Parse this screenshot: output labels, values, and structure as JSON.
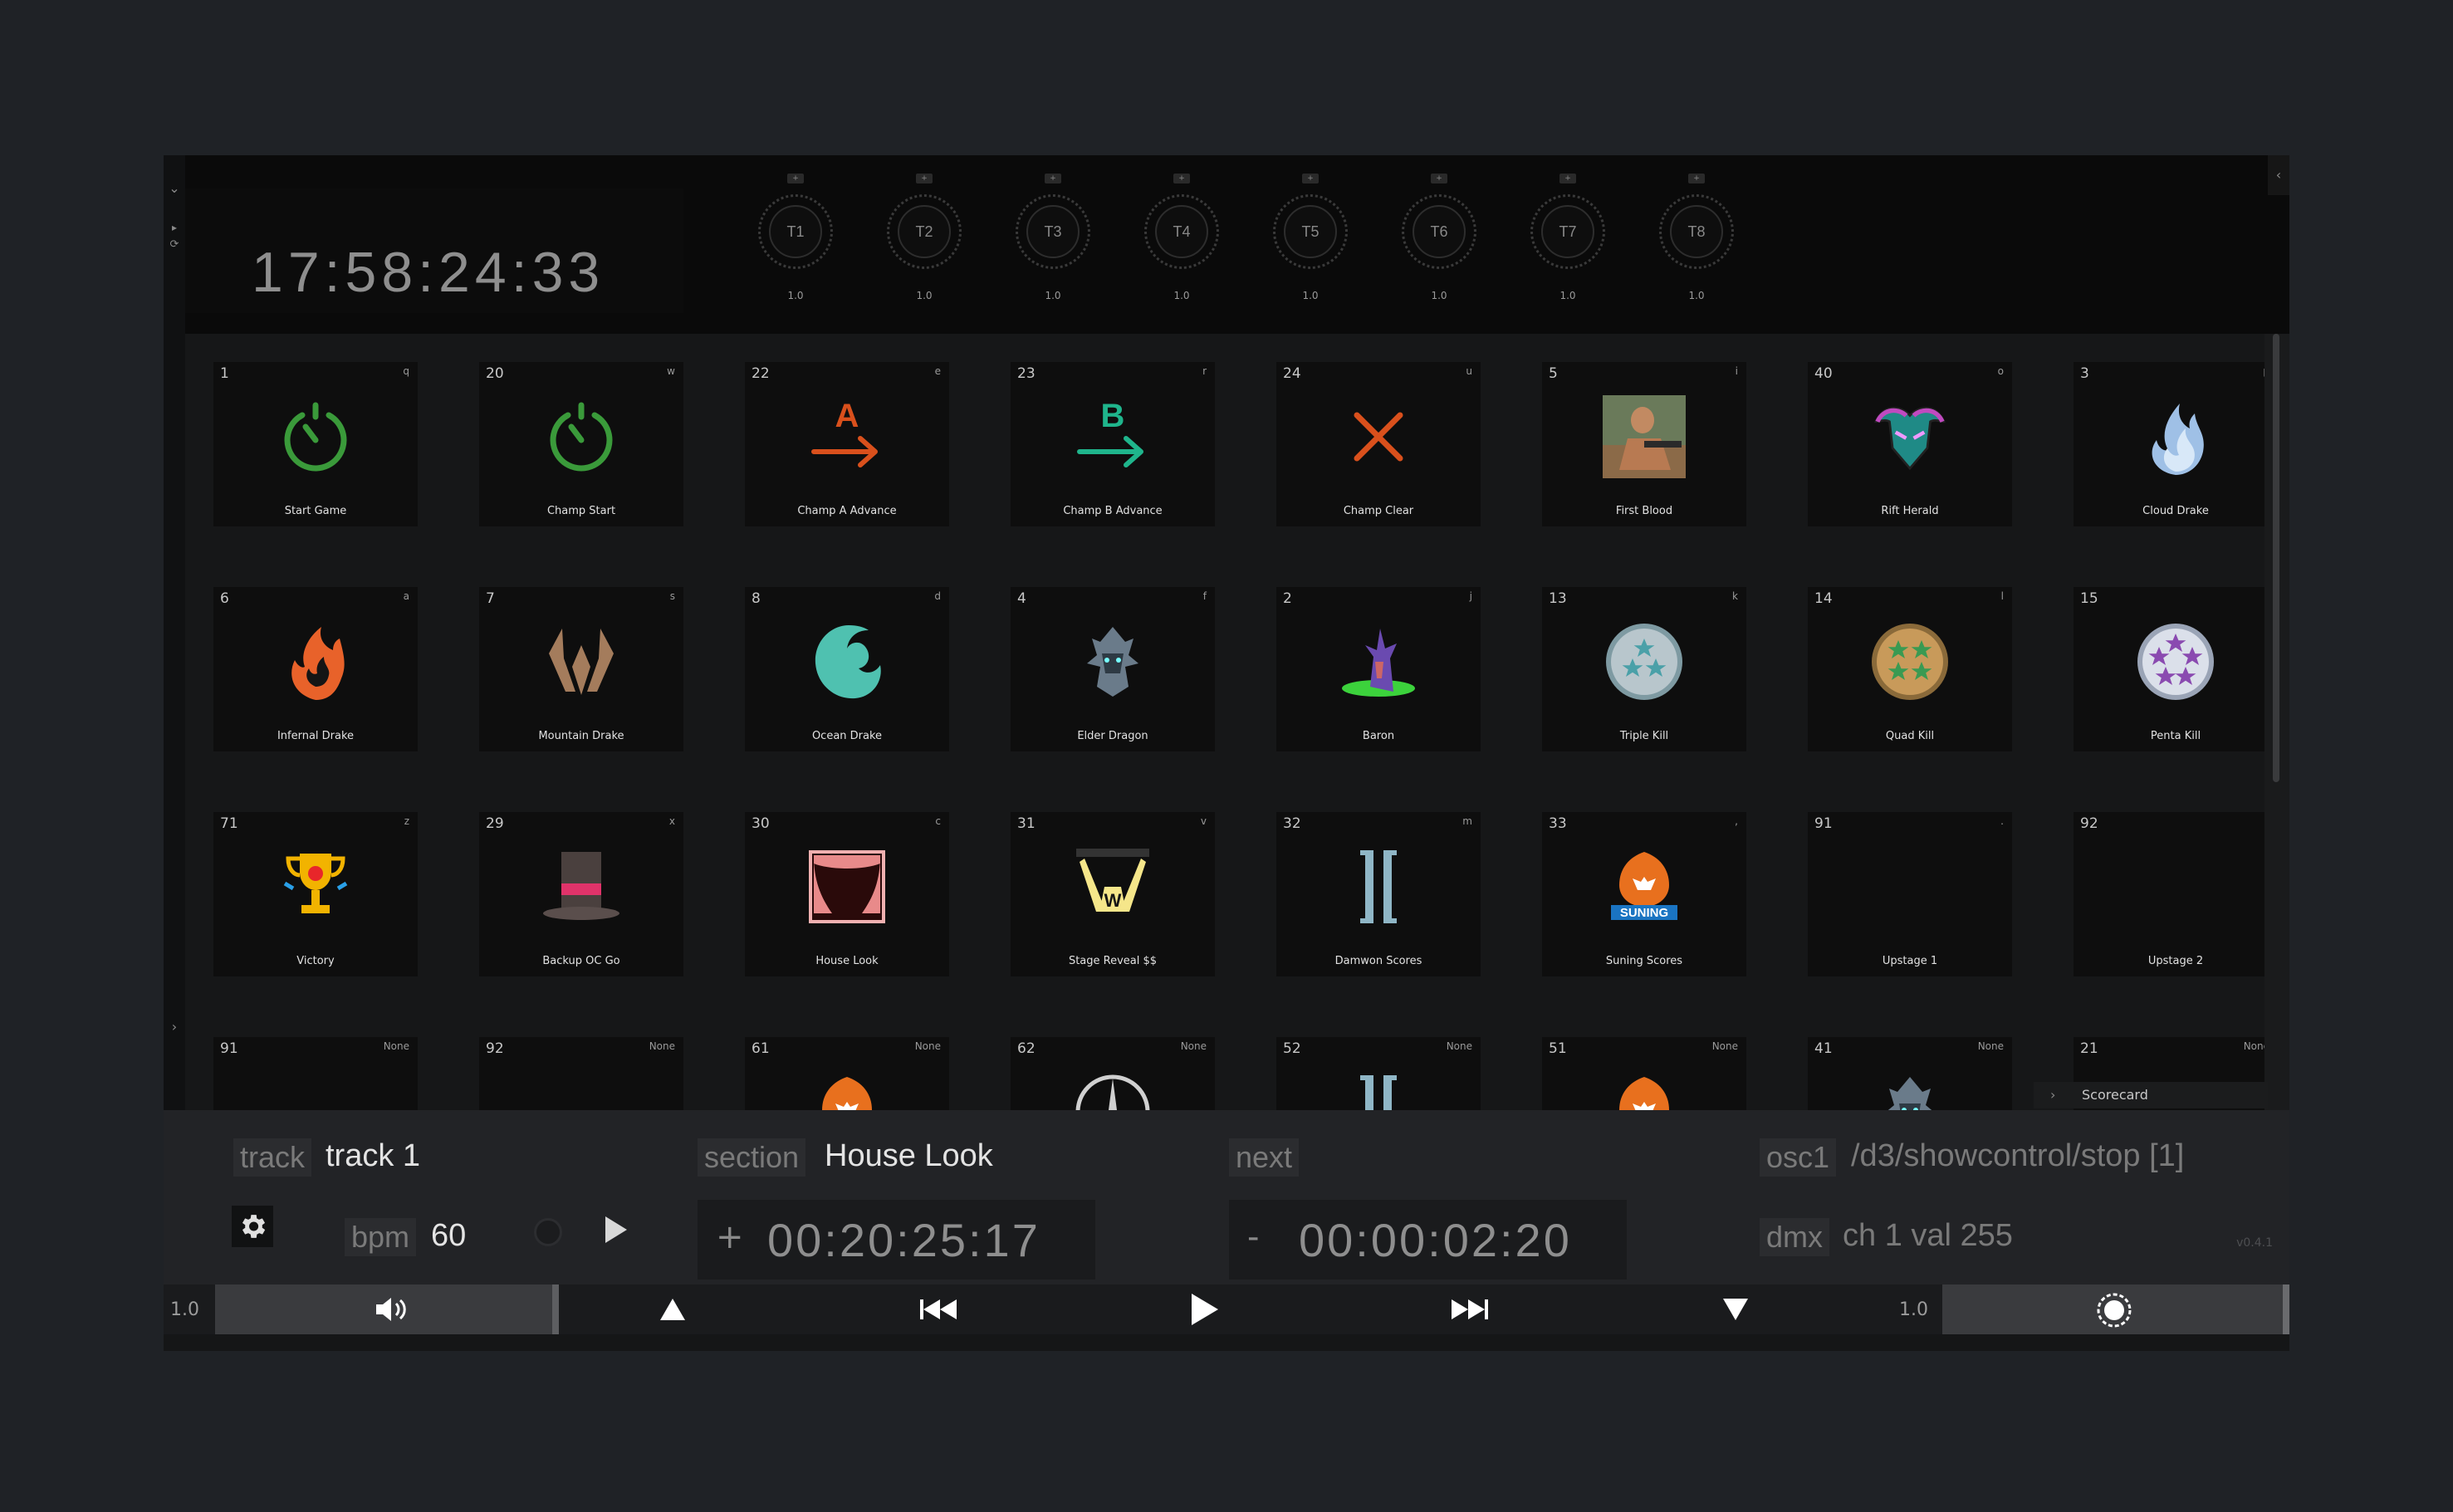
{
  "clock": {
    "time": "17:58:24:33"
  },
  "knobs": [
    {
      "label": "T1",
      "value": "1.0"
    },
    {
      "label": "T2",
      "value": "1.0"
    },
    {
      "label": "T3",
      "value": "1.0"
    },
    {
      "label": "T4",
      "value": "1.0"
    },
    {
      "label": "T5",
      "value": "1.0"
    },
    {
      "label": "T6",
      "value": "1.0"
    },
    {
      "label": "T7",
      "value": "1.0"
    },
    {
      "label": "T8",
      "value": "1.0"
    }
  ],
  "tiles": [
    {
      "id": "1",
      "key": "q",
      "label": "Start Game",
      "icon": "power-timer-green-icon"
    },
    {
      "id": "20",
      "key": "w",
      "label": "Champ Start",
      "icon": "power-timer-green-icon"
    },
    {
      "id": "22",
      "key": "e",
      "label": "Champ A Advance",
      "icon": "arrow-a-orange-icon"
    },
    {
      "id": "23",
      "key": "r",
      "label": "Champ B Advance",
      "icon": "arrow-b-teal-icon"
    },
    {
      "id": "24",
      "key": "u",
      "label": "Champ Clear",
      "icon": "x-orange-icon"
    },
    {
      "id": "5",
      "key": "i",
      "label": "First Blood",
      "icon": "first-blood-photo-icon"
    },
    {
      "id": "40",
      "key": "o",
      "label": "Rift Herald",
      "icon": "rift-herald-icon"
    },
    {
      "id": "3",
      "key": "p",
      "label": "Cloud Drake",
      "icon": "cloud-drake-icon"
    },
    {
      "id": "6",
      "key": "a",
      "label": "Infernal Drake",
      "icon": "infernal-drake-icon"
    },
    {
      "id": "7",
      "key": "s",
      "label": "Mountain Drake",
      "icon": "mountain-drake-icon"
    },
    {
      "id": "8",
      "key": "d",
      "label": "Ocean Drake",
      "icon": "ocean-drake-icon"
    },
    {
      "id": "4",
      "key": "f",
      "label": "Elder Dragon",
      "icon": "elder-dragon-icon"
    },
    {
      "id": "2",
      "key": "j",
      "label": "Baron",
      "icon": "baron-icon"
    },
    {
      "id": "13",
      "key": "k",
      "label": "Triple Kill",
      "icon": "triple-kill-badge-icon"
    },
    {
      "id": "14",
      "key": "l",
      "label": "Quad Kill",
      "icon": "quad-kill-badge-icon"
    },
    {
      "id": "15",
      "key": ";",
      "label": "Penta Kill",
      "icon": "penta-kill-badge-icon"
    },
    {
      "id": "71",
      "key": "z",
      "label": "Victory",
      "icon": "trophy-icon"
    },
    {
      "id": "29",
      "key": "x",
      "label": "Backup OC Go",
      "icon": "top-hat-icon"
    },
    {
      "id": "30",
      "key": "c",
      "label": "House Look",
      "icon": "theater-curtain-icon"
    },
    {
      "id": "31",
      "key": "v",
      "label": "Stage Reveal $$",
      "icon": "stage-spotlights-icon"
    },
    {
      "id": "32",
      "key": "m",
      "label": "Damwon Scores",
      "icon": "damwon-logo-icon"
    },
    {
      "id": "33",
      "key": ",",
      "label": "Suning Scores",
      "icon": "suning-logo-icon"
    },
    {
      "id": "91",
      "key": ".",
      "label": "Upstage 1",
      "icon": ""
    },
    {
      "id": "92",
      "key": "/",
      "label": "Upstage 2",
      "icon": ""
    },
    {
      "id": "91",
      "key": "None",
      "label": "",
      "icon": ""
    },
    {
      "id": "92",
      "key": "None",
      "label": "",
      "icon": ""
    },
    {
      "id": "61",
      "key": "None",
      "label": "",
      "icon": "suning-logo-icon"
    },
    {
      "id": "62",
      "key": "None",
      "label": "",
      "icon": "mercedes-logo-icon"
    },
    {
      "id": "52",
      "key": "None",
      "label": "",
      "icon": "damwon-logo-icon"
    },
    {
      "id": "51",
      "key": "None",
      "label": "",
      "icon": "suning-logo-icon"
    },
    {
      "id": "41",
      "key": "None",
      "label": "",
      "icon": "elder-dragon-icon"
    },
    {
      "id": "21",
      "key": "None",
      "label": "",
      "icon": ""
    }
  ],
  "scorecard": {
    "label": "Scorecard"
  },
  "info": {
    "track_tag": "track",
    "track_value": "track 1",
    "section_tag": "section",
    "section_value": "House Look",
    "next_tag": "next",
    "osc_tag": "osc1",
    "osc_value": "/d3/showcontrol/stop [1]",
    "dmx_tag": "dmx",
    "dmx_value": "ch 1 val 255",
    "bpm_tag": "bpm",
    "bpm_value": "60",
    "section_sign": "+",
    "section_timer": "00:20:25:17",
    "next_sign": "-",
    "next_timer": "00:00:02:20",
    "version": "v0.4.1"
  },
  "transport": {
    "volume_value": "1.0",
    "brightness_value": "1.0"
  },
  "colors": {
    "green": "#3a9a3a",
    "orange": "#d9501c",
    "teal": "#1fb58c",
    "ocean": "#4fc1b0"
  }
}
